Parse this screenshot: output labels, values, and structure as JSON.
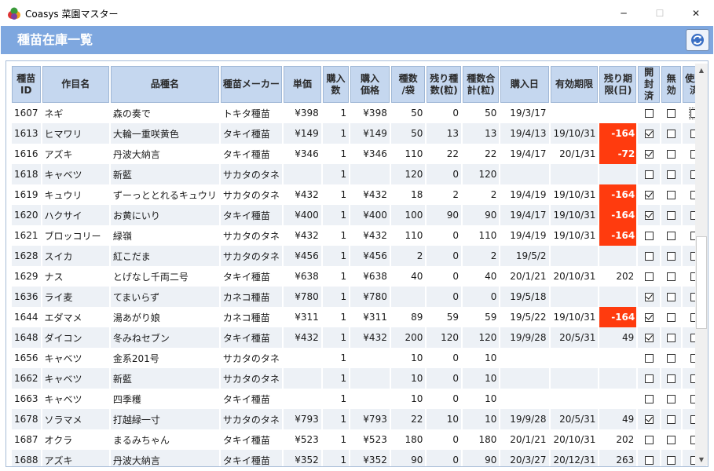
{
  "window": {
    "title": "Coasys 菜園マスター",
    "icon": "fruit-app-icon",
    "controls": {
      "minimize": "─",
      "maximize": "☐",
      "close": "✕"
    }
  },
  "header": {
    "title": "種苗在庫一覧",
    "refresh_icon": "refresh-icon",
    "color": "#7ea7df"
  },
  "colors": {
    "header_bg": "#7ea7df",
    "column_header_bg": "#c5d7ef",
    "negative_badge": "#ff3b0e",
    "alt_row": "#edf1f6"
  },
  "table": {
    "columns": [
      "種苗\nID",
      "作目名",
      "品種名",
      "種苗メーカー",
      "単価",
      "購入\n数",
      "購入\n価格",
      "種数\n/袋",
      "残り種\n数(粒)",
      "種数合\n計(粒)",
      "購入日",
      "有効期限",
      "残り期\n限(日)",
      "開封\n済",
      "無\n効",
      "使用\n済"
    ],
    "rows": [
      {
        "id": "1607",
        "crop": "ネギ",
        "variety": "森の奏で",
        "maker": "トキタ種苗",
        "price": "¥398",
        "qty": "1",
        "cost": "¥398",
        "per_bag": "50",
        "remaining": "0",
        "total": "50",
        "purchased": "19/3/17",
        "expiry": "",
        "days_left": "",
        "opened": false,
        "invalid": false,
        "used": false,
        "used_focus": true
      },
      {
        "id": "1613",
        "crop": "ヒマワリ",
        "variety": "大輪一重咲黄色",
        "maker": "タキイ種苗",
        "price": "¥149",
        "qty": "1",
        "cost": "¥149",
        "per_bag": "50",
        "remaining": "13",
        "total": "13",
        "purchased": "19/4/13",
        "expiry": "19/10/31",
        "days_left": "-164",
        "opened": true,
        "invalid": false,
        "used": false
      },
      {
        "id": "1616",
        "crop": "アズキ",
        "variety": "丹波大納言",
        "maker": "タキイ種苗",
        "price": "¥346",
        "qty": "1",
        "cost": "¥346",
        "per_bag": "110",
        "remaining": "22",
        "total": "22",
        "purchased": "19/4/17",
        "expiry": "20/1/31",
        "days_left": "-72",
        "opened": true,
        "invalid": false,
        "used": false
      },
      {
        "id": "1618",
        "crop": "キャベツ",
        "variety": "新藍",
        "maker": "サカタのタネ",
        "price": "",
        "qty": "1",
        "cost": "",
        "per_bag": "120",
        "remaining": "0",
        "total": "120",
        "purchased": "",
        "expiry": "",
        "days_left": "",
        "opened": false,
        "invalid": false,
        "used": false
      },
      {
        "id": "1619",
        "crop": "キュウリ",
        "variety": "ずーっととれるキュウリ",
        "maker": "サカタのタネ",
        "price": "¥432",
        "qty": "1",
        "cost": "¥432",
        "per_bag": "18",
        "remaining": "2",
        "total": "2",
        "purchased": "19/4/19",
        "expiry": "19/10/31",
        "days_left": "-164",
        "opened": true,
        "invalid": false,
        "used": false
      },
      {
        "id": "1620",
        "crop": "ハクサイ",
        "variety": "お黄にいり",
        "maker": "タキイ種苗",
        "price": "¥400",
        "qty": "1",
        "cost": "¥400",
        "per_bag": "100",
        "remaining": "90",
        "total": "90",
        "purchased": "19/4/17",
        "expiry": "19/10/31",
        "days_left": "-164",
        "opened": true,
        "invalid": false,
        "used": false
      },
      {
        "id": "1621",
        "crop": "ブロッコリー",
        "variety": "緑嶺",
        "maker": "サカタのタネ",
        "price": "¥432",
        "qty": "1",
        "cost": "¥432",
        "per_bag": "110",
        "remaining": "0",
        "total": "110",
        "purchased": "19/4/19",
        "expiry": "19/10/31",
        "days_left": "-164",
        "opened": false,
        "invalid": false,
        "used": false
      },
      {
        "id": "1628",
        "crop": "スイカ",
        "variety": "紅こだま",
        "maker": "サカタのタネ",
        "price": "¥456",
        "qty": "1",
        "cost": "¥456",
        "per_bag": "2",
        "remaining": "0",
        "total": "2",
        "purchased": "19/5/2",
        "expiry": "",
        "days_left": "",
        "opened": false,
        "invalid": false,
        "used": false
      },
      {
        "id": "1629",
        "crop": "ナス",
        "variety": "とげなし千両二号",
        "maker": "タキイ種苗",
        "price": "¥638",
        "qty": "1",
        "cost": "¥638",
        "per_bag": "40",
        "remaining": "0",
        "total": "40",
        "purchased": "20/1/21",
        "expiry": "20/10/31",
        "days_left": "202",
        "opened": false,
        "invalid": false,
        "used": false
      },
      {
        "id": "1636",
        "crop": "ライ麦",
        "variety": "てまいらず",
        "maker": "カネコ種苗",
        "price": "¥780",
        "qty": "1",
        "cost": "¥780",
        "per_bag": "",
        "remaining": "0",
        "total": "0",
        "purchased": "19/5/18",
        "expiry": "",
        "days_left": "",
        "opened": true,
        "invalid": false,
        "used": false
      },
      {
        "id": "1644",
        "crop": "エダマメ",
        "variety": "湯あがり娘",
        "maker": "カネコ種苗",
        "price": "¥311",
        "qty": "1",
        "cost": "¥311",
        "per_bag": "89",
        "remaining": "59",
        "total": "59",
        "purchased": "19/5/22",
        "expiry": "19/10/31",
        "days_left": "-164",
        "opened": true,
        "invalid": false,
        "used": false
      },
      {
        "id": "1648",
        "crop": "ダイコン",
        "variety": "冬みねセブン",
        "maker": "タキイ種苗",
        "price": "¥432",
        "qty": "1",
        "cost": "¥432",
        "per_bag": "200",
        "remaining": "120",
        "total": "120",
        "purchased": "19/9/28",
        "expiry": "20/5/31",
        "days_left": "49",
        "opened": true,
        "invalid": false,
        "used": false
      },
      {
        "id": "1656",
        "crop": "キャベツ",
        "variety": "金系201号",
        "maker": "サカタのタネ",
        "price": "",
        "qty": "1",
        "cost": "",
        "per_bag": "10",
        "remaining": "0",
        "total": "10",
        "purchased": "",
        "expiry": "",
        "days_left": "",
        "opened": false,
        "invalid": false,
        "used": false
      },
      {
        "id": "1662",
        "crop": "キャベツ",
        "variety": "新藍",
        "maker": "サカタのタネ",
        "price": "",
        "qty": "1",
        "cost": "",
        "per_bag": "10",
        "remaining": "0",
        "total": "10",
        "purchased": "",
        "expiry": "",
        "days_left": "",
        "opened": false,
        "invalid": false,
        "used": false
      },
      {
        "id": "1663",
        "crop": "キャベツ",
        "variety": "四季穫",
        "maker": "タキイ種苗",
        "price": "",
        "qty": "1",
        "cost": "",
        "per_bag": "10",
        "remaining": "0",
        "total": "10",
        "purchased": "",
        "expiry": "",
        "days_left": "",
        "opened": false,
        "invalid": false,
        "used": false
      },
      {
        "id": "1678",
        "crop": "ソラマメ",
        "variety": "打越緑一寸",
        "maker": "サカタのタネ",
        "price": "¥793",
        "qty": "1",
        "cost": "¥793",
        "per_bag": "22",
        "remaining": "10",
        "total": "10",
        "purchased": "19/9/28",
        "expiry": "20/5/31",
        "days_left": "49",
        "opened": true,
        "invalid": false,
        "used": false
      },
      {
        "id": "1687",
        "crop": "オクラ",
        "variety": "まるみちゃん",
        "maker": "タキイ種苗",
        "price": "¥523",
        "qty": "1",
        "cost": "¥523",
        "per_bag": "180",
        "remaining": "0",
        "total": "180",
        "purchased": "20/1/21",
        "expiry": "20/10/31",
        "days_left": "202",
        "opened": false,
        "invalid": false,
        "used": false
      },
      {
        "id": "1688",
        "crop": "アズキ",
        "variety": "丹波大納言",
        "maker": "タキイ種苗",
        "price": "¥352",
        "qty": "1",
        "cost": "¥352",
        "per_bag": "90",
        "remaining": "0",
        "total": "90",
        "purchased": "20/3/27",
        "expiry": "20/12/31",
        "days_left": "263",
        "opened": false,
        "invalid": false,
        "used": false
      }
    ]
  }
}
